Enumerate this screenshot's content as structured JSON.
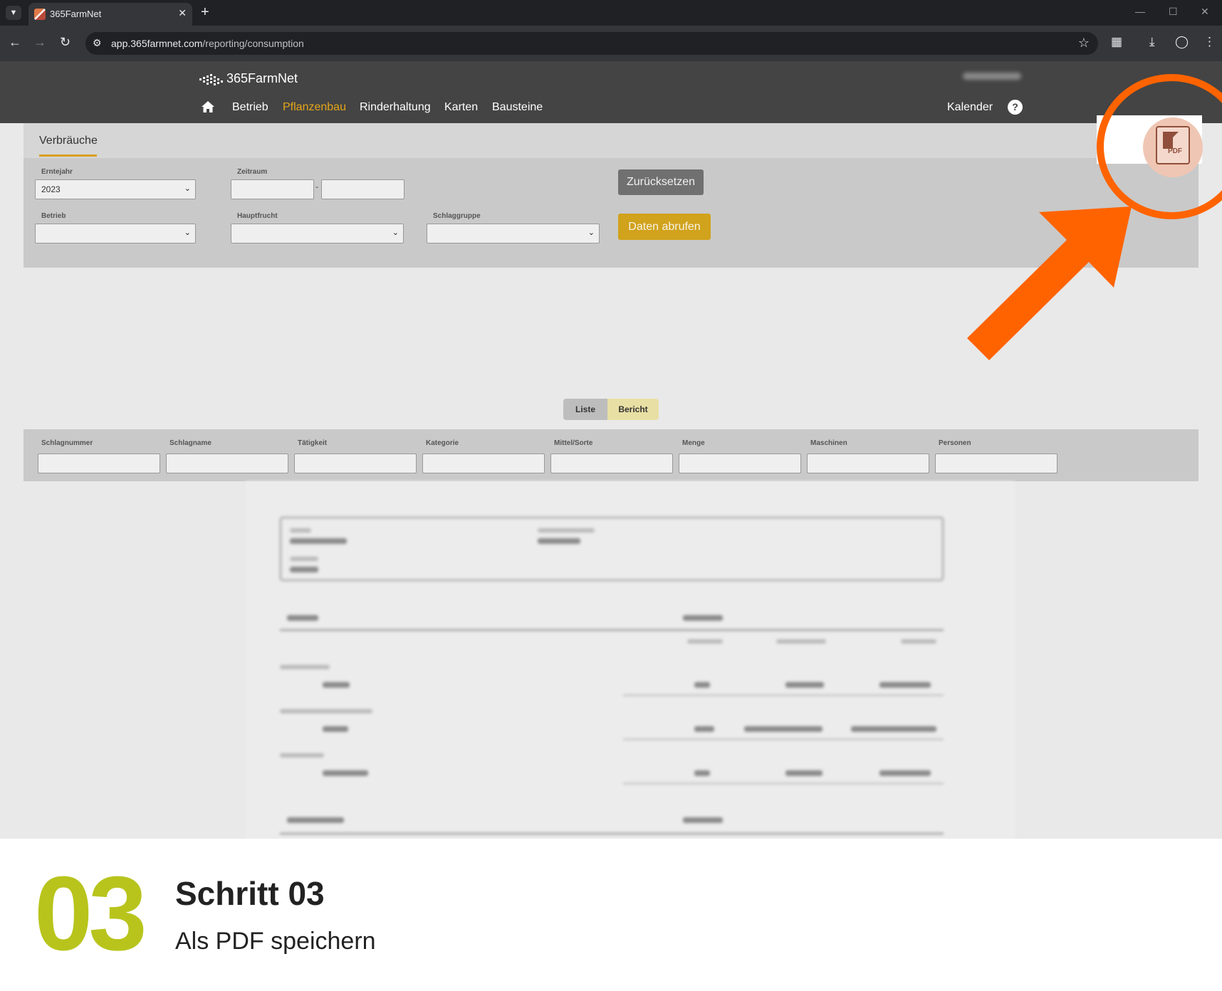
{
  "browser": {
    "tab_title": "365FarmNet",
    "url_host": "app.365farmnet.com",
    "url_path": "/reporting/consumption"
  },
  "app": {
    "brand": "365FarmNet",
    "nav": [
      "Betrieb",
      "Pflanzenbau",
      "Rinderhaltung",
      "Karten",
      "Bausteine"
    ],
    "active_nav": "Pflanzenbau",
    "kalender": "Kalender",
    "help": "?"
  },
  "page": {
    "tab": "Verbräuche",
    "filters": {
      "erntejahr_label": "Erntejahr",
      "erntejahr_value": "2023",
      "zeitraum_label": "Zeitraum",
      "zeitraum_sep": "-",
      "betrieb_label": "Betrieb",
      "hauptfrucht_label": "Hauptfrucht",
      "schlaggruppe_label": "Schlaggruppe"
    },
    "buttons": {
      "reset": "Zurücksetzen",
      "load": "Daten abrufen"
    },
    "view_toggle": {
      "list": "Liste",
      "report": "Bericht",
      "active": "Bericht"
    },
    "columns": [
      "Schlagnummer",
      "Schlagname",
      "Tätigkeit",
      "Kategorie",
      "Mittel/Sorte",
      "Menge",
      "Maschinen",
      "Personen"
    ],
    "pdf_label": "PDF"
  },
  "colors": {
    "accent": "#d9a020",
    "highlight": "#ff6300",
    "step_number": "#b8c41c"
  },
  "step": {
    "number": "03",
    "title": "Schritt 03",
    "subtitle": "Als PDF speichern"
  }
}
